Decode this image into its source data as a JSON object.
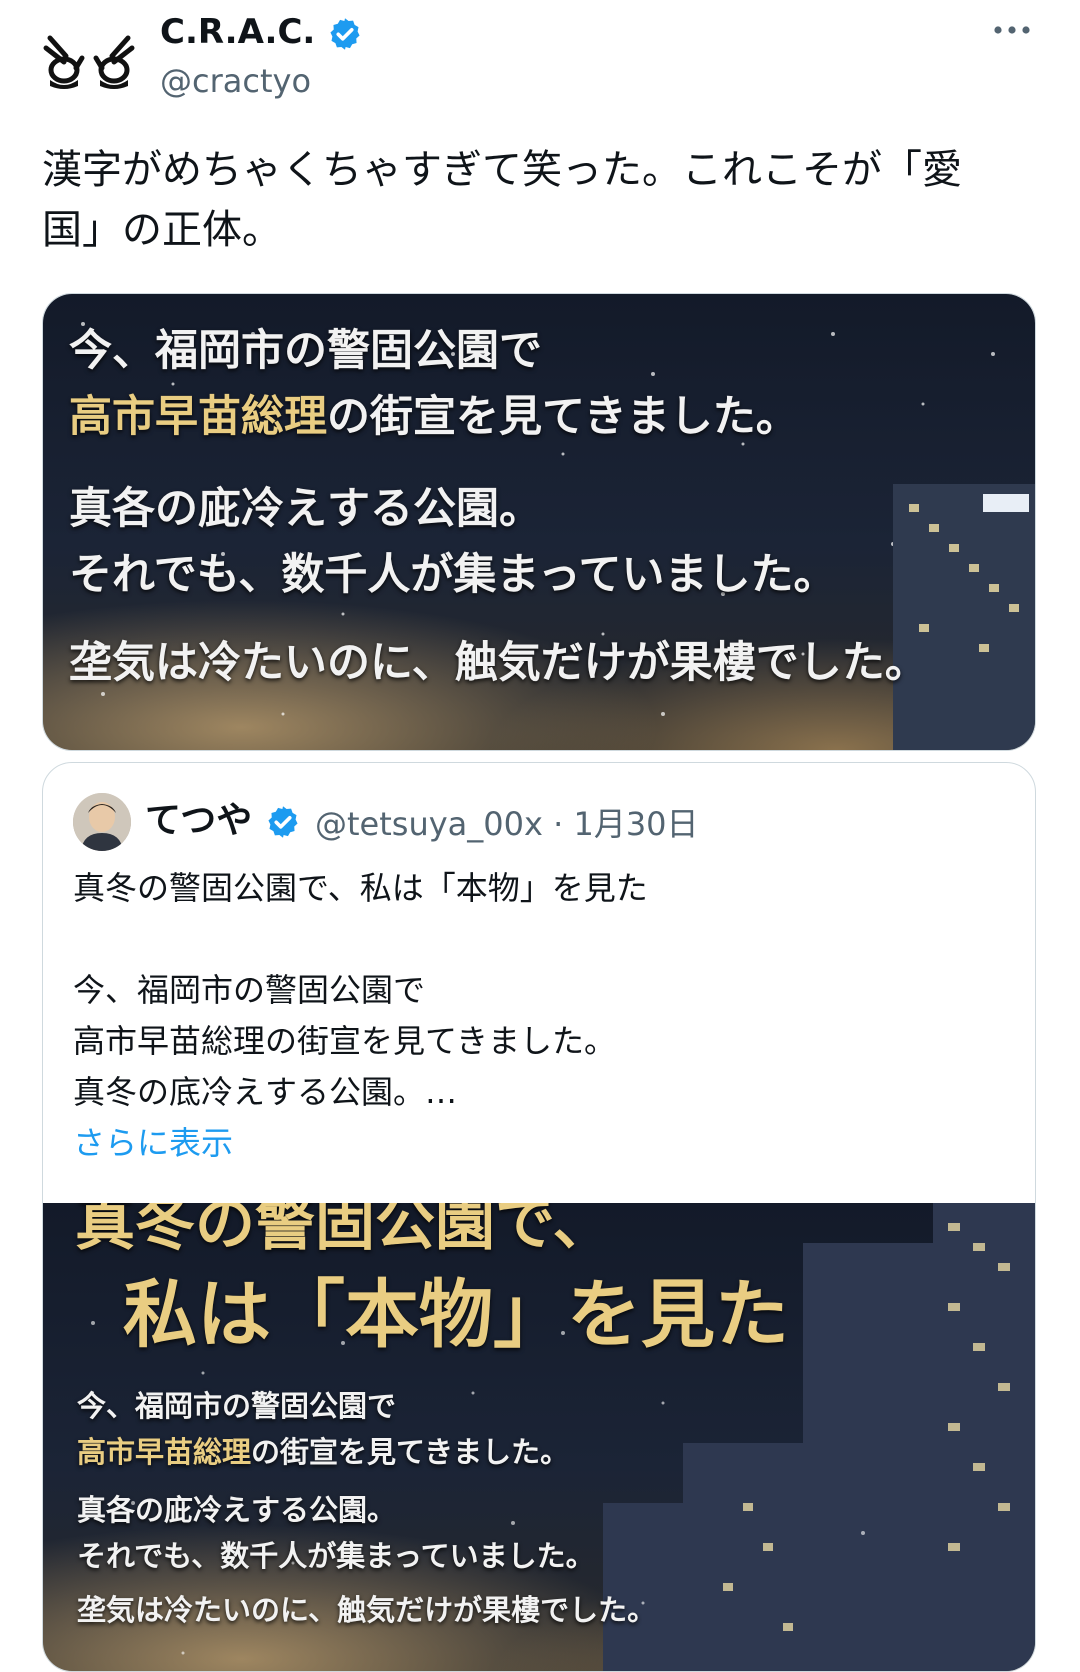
{
  "author": {
    "name": "C.R.A.C.",
    "handle": "@cractyo",
    "avatar_icon": "ok-hands-logo-icon",
    "verified_color": "#1d9bf0"
  },
  "tweet": {
    "text_lines": [
      "漢字がめちゃくちゃすぎて笑った。これこそが「愛",
      "国」の正体。"
    ]
  },
  "image1": {
    "lines": [
      {
        "text": "今、福岡市の警固公園で"
      },
      {
        "gold": "高市早苗総理",
        "text": "の街宣を見てきました。"
      },
      {
        "text": "真各の庛冷えする公園。"
      },
      {
        "text": "それでも、数千人が集まっていました。"
      },
      {
        "text": "垄気は冷たいのに、触気だけが果樓でした。"
      }
    ]
  },
  "quote": {
    "name": "てつや",
    "handle": "@tetsuya_00x",
    "separator": "·",
    "date": "1月30日",
    "lines": [
      "真冬の警固公園で、私は「本物」を見た",
      "",
      "今、福岡市の警固公園で",
      "高市早苗総理の街宣を見てきました。",
      "真冬の底冷えする公園。…"
    ],
    "show_more": "さらに表示"
  },
  "image2": {
    "top_line": "真冬の警固公園で、",
    "headline": "私は「本物」を見た",
    "lines": [
      {
        "text": "今、福岡市の警固公園で"
      },
      {
        "gold": "高市早苗総理",
        "text": "の街宣を見てきました。"
      },
      {
        "text": "真各の庛冷えする公園。"
      },
      {
        "text": "それでも、数千人が集まっていました。"
      },
      {
        "text": "垄気は冷たいのに、触気だけが果樓でした。"
      }
    ]
  }
}
